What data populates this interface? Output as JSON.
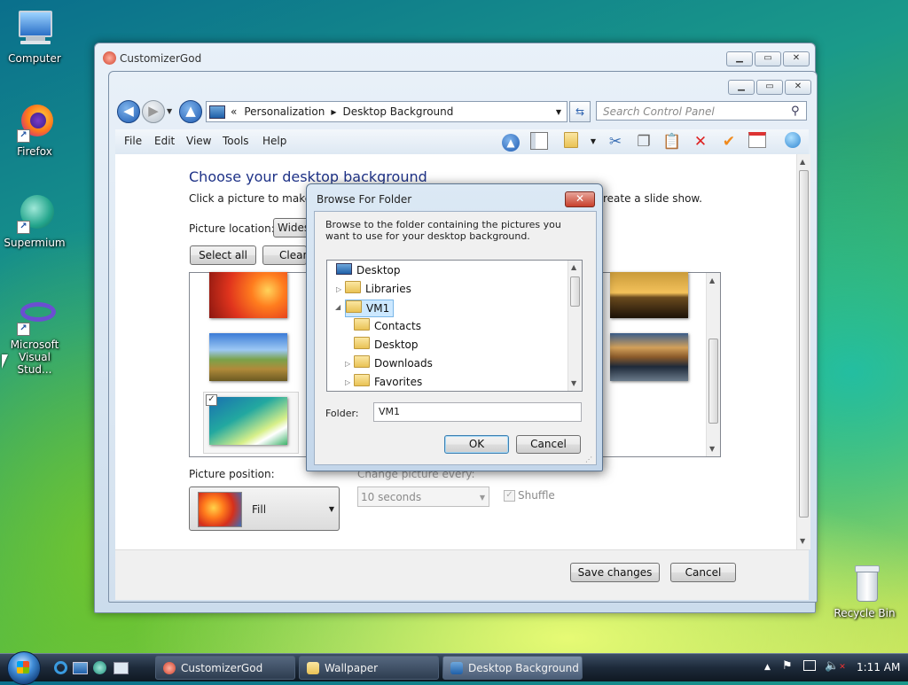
{
  "desktop": {
    "icons": [
      {
        "label": "Computer"
      },
      {
        "label": "Firefox"
      },
      {
        "label": "Supermium"
      },
      {
        "label": "Microsoft Visual Stud..."
      },
      {
        "label": "Recycle Bin"
      }
    ]
  },
  "outer_window": {
    "title": "CustomizerGod"
  },
  "explorer": {
    "breadcrumb": [
      "Personalization",
      "Desktop Background"
    ],
    "breadcrumb_prefix": "«",
    "search_placeholder": "Search Control Panel",
    "menu": [
      "File",
      "Edit",
      "View",
      "Tools",
      "Help"
    ],
    "heading": "Choose your desktop background",
    "instructions_left": "Click a picture to make it",
    "instructions_right": "reate a slide show.",
    "picture_location_label": "Picture location:",
    "picture_location_value": "Wides",
    "select_all": "Select all",
    "clear_all": "Clear",
    "picture_position_label": "Picture position:",
    "picture_position_value": "Fill",
    "change_picture_label": "Change picture every:",
    "change_picture_value": "10 seconds",
    "shuffle_label": "Shuffle",
    "save_changes": "Save changes",
    "cancel": "Cancel"
  },
  "dialog": {
    "title": "Browse For Folder",
    "description": "Browse to the folder containing the pictures you want to use for your desktop background.",
    "tree": [
      {
        "label": "Desktop",
        "level": 0
      },
      {
        "label": "Libraries",
        "level": 1
      },
      {
        "label": "VM1",
        "level": 1,
        "selected": true
      },
      {
        "label": "Contacts",
        "level": 2
      },
      {
        "label": "Desktop",
        "level": 2
      },
      {
        "label": "Downloads",
        "level": 2
      },
      {
        "label": "Favorites",
        "level": 2
      }
    ],
    "folder_label": "Folder:",
    "folder_value": "VM1",
    "ok": "OK",
    "cancel": "Cancel"
  },
  "taskbar": {
    "buttons": [
      {
        "label": "CustomizerGod",
        "active": false
      },
      {
        "label": "Wallpaper",
        "active": false
      },
      {
        "label": "Desktop Background",
        "active": true
      }
    ],
    "clock": "1:11 AM"
  },
  "colors": {
    "heading": "#1e3287",
    "selected_highlight": "#cce8ff",
    "close_button": "#c8402b"
  }
}
